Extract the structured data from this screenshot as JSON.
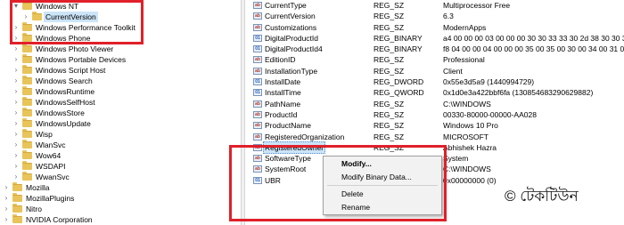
{
  "tree": {
    "items": [
      {
        "label": "Windows NT",
        "indent": 1,
        "arrow": "▾"
      },
      {
        "label": "CurrentVersion",
        "indent": 2,
        "arrow": "›",
        "selected": true
      },
      {
        "label": "Windows Performance Toolkit",
        "indent": 1,
        "arrow": "›"
      },
      {
        "label": "Windows Phone",
        "indent": 1,
        "arrow": "›"
      },
      {
        "label": "Windows Photo Viewer",
        "indent": 1,
        "arrow": "›"
      },
      {
        "label": "Windows Portable Devices",
        "indent": 1,
        "arrow": "›"
      },
      {
        "label": "Windows Script Host",
        "indent": 1,
        "arrow": "›"
      },
      {
        "label": "Windows Search",
        "indent": 1,
        "arrow": "›"
      },
      {
        "label": "WindowsRuntime",
        "indent": 1,
        "arrow": "›"
      },
      {
        "label": "WindowsSelfHost",
        "indent": 1,
        "arrow": "›"
      },
      {
        "label": "WindowsStore",
        "indent": 1,
        "arrow": "›"
      },
      {
        "label": "WindowsUpdate",
        "indent": 1,
        "arrow": "›"
      },
      {
        "label": "Wisp",
        "indent": 1,
        "arrow": "›"
      },
      {
        "label": "WlanSvc",
        "indent": 1,
        "arrow": "›"
      },
      {
        "label": "Wow64",
        "indent": 1,
        "arrow": "›"
      },
      {
        "label": "WSDAPI",
        "indent": 1,
        "arrow": "›"
      },
      {
        "label": "WwanSvc",
        "indent": 1,
        "arrow": "›"
      },
      {
        "label": "Mozilla",
        "indent": 0,
        "arrow": "›"
      },
      {
        "label": "MozillaPlugins",
        "indent": 0,
        "arrow": "›"
      },
      {
        "label": "Nitro",
        "indent": 0,
        "arrow": "›"
      },
      {
        "label": "NVIDIA Corporation",
        "indent": 0,
        "arrow": "›"
      }
    ]
  },
  "values": {
    "rows": [
      {
        "name": "CurrentType",
        "type": "REG_SZ",
        "data": "Multiprocessor Free",
        "icon": "string-value-icon"
      },
      {
        "name": "CurrentVersion",
        "type": "REG_SZ",
        "data": "6.3",
        "icon": "string-value-icon"
      },
      {
        "name": "Customizations",
        "type": "REG_SZ",
        "data": "ModernApps",
        "icon": "string-value-icon"
      },
      {
        "name": "DigitalProductId",
        "type": "REG_BINARY",
        "data": "a4 00 00 00 03 00 00 00 30 30 33 33 30 2d 38 30 30 3",
        "icon": "binary-value-icon"
      },
      {
        "name": "DigitalProductId4",
        "type": "REG_BINARY",
        "data": "f8 04 00 00 04 00 00 00 35 00 35 00 30 00 34 00 31 00",
        "icon": "binary-value-icon"
      },
      {
        "name": "EditionID",
        "type": "REG_SZ",
        "data": "Professional",
        "icon": "string-value-icon"
      },
      {
        "name": "InstallationType",
        "type": "REG_SZ",
        "data": "Client",
        "icon": "string-value-icon"
      },
      {
        "name": "InstallDate",
        "type": "REG_DWORD",
        "data": "0x55e3d5a9 (1440994729)",
        "icon": "binary-value-icon"
      },
      {
        "name": "InstallTime",
        "type": "REG_QWORD",
        "data": "0x1d0e3a422bbf6fa (130854683290629882)",
        "icon": "binary-value-icon"
      },
      {
        "name": "PathName",
        "type": "REG_SZ",
        "data": "C:\\WINDOWS",
        "icon": "string-value-icon"
      },
      {
        "name": "ProductId",
        "type": "REG_SZ",
        "data": "00330-80000-00000-AA028",
        "icon": "string-value-icon"
      },
      {
        "name": "ProductName",
        "type": "REG_SZ",
        "data": "Windows 10 Pro",
        "icon": "string-value-icon"
      },
      {
        "name": "RegisteredOrganization",
        "type": "REG_SZ",
        "data": "MICROSOFT",
        "icon": "string-value-icon"
      },
      {
        "name": "RegisteredOwner",
        "type": "REG_SZ",
        "data": "Abhishek Hazra",
        "icon": "string-value-icon",
        "selected": true
      },
      {
        "name": "SoftwareType",
        "type": "REG_SZ",
        "data": "System",
        "icon": "string-value-icon"
      },
      {
        "name": "SystemRoot",
        "type": "REG_SZ",
        "data": "C:\\WINDOWS",
        "icon": "string-value-icon"
      },
      {
        "name": "UBR",
        "type": "REG_DWORD",
        "data": "0x00000000 (0)",
        "icon": "binary-value-icon"
      }
    ]
  },
  "context_menu": {
    "items": [
      "Modify...",
      "Modify Binary Data...",
      "Delete",
      "Rename"
    ]
  },
  "watermark": "© টেকটিউন",
  "colors": {
    "annotation_red": "#e0202a",
    "selection": "#cce4f7",
    "folder": "#e8c45a"
  }
}
